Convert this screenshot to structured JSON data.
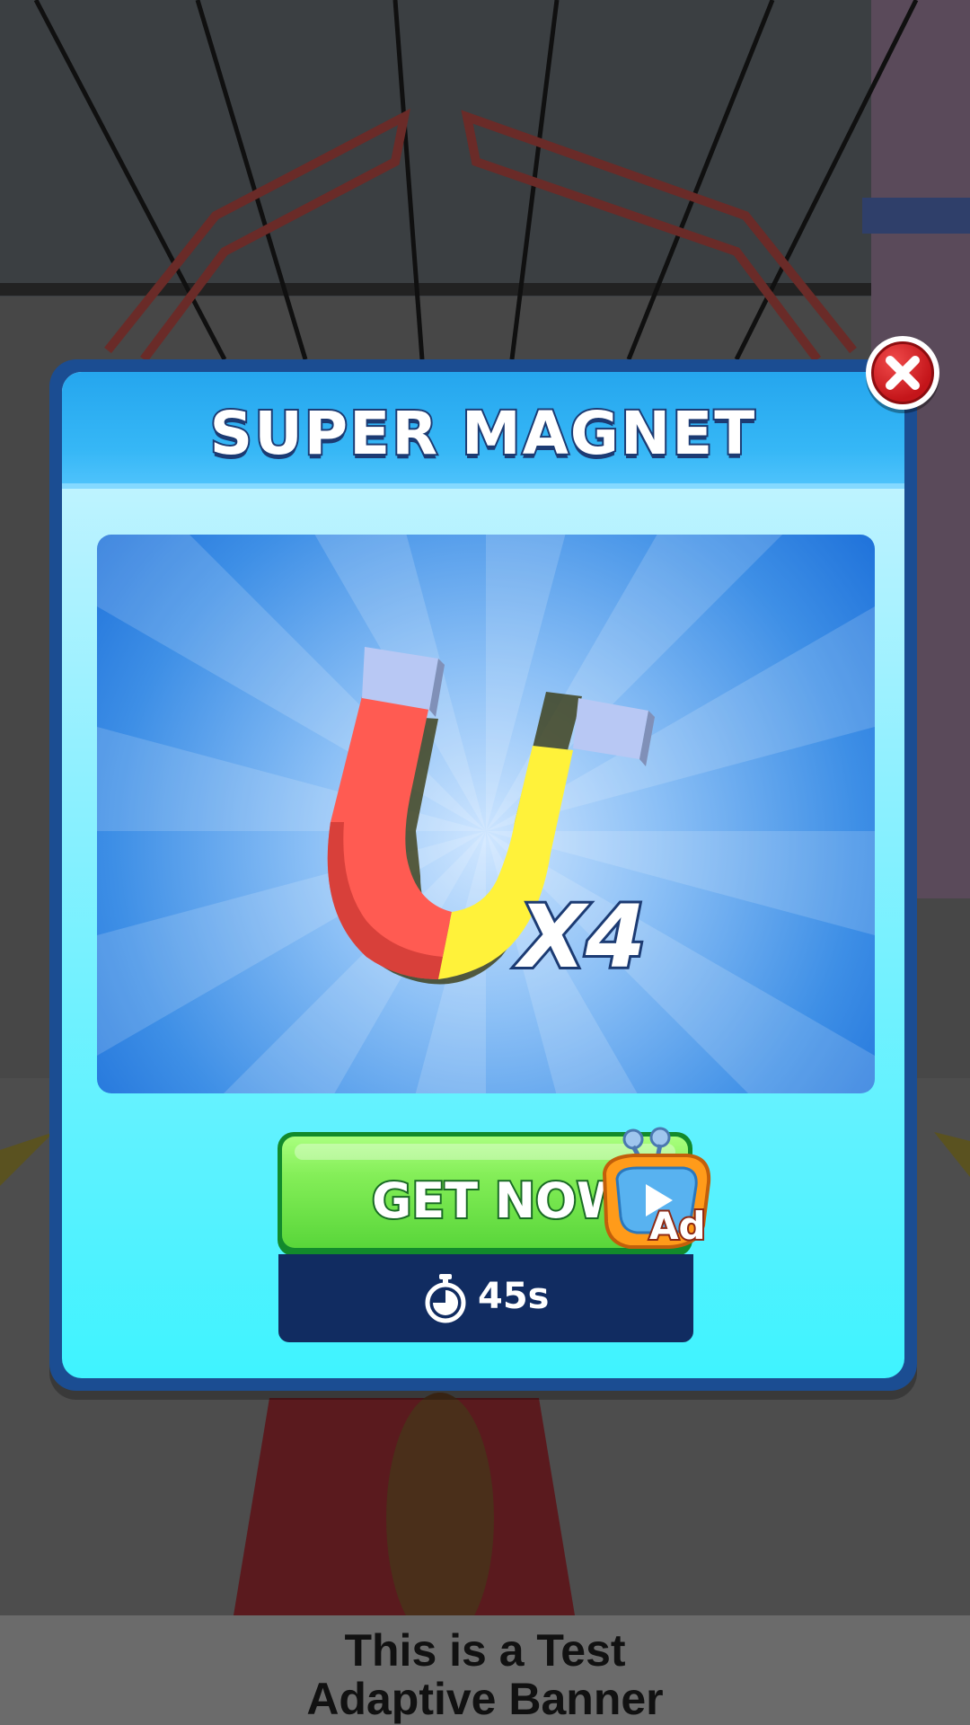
{
  "popup": {
    "title": "SUPER MAGNET",
    "multiplier": "X4",
    "get_now_label": "GET NOW",
    "ad_badge_label": "Ad",
    "timer_text": "45s"
  },
  "banner": {
    "line1": "This is a Test",
    "line2": "Adaptive Banner"
  },
  "icons": {
    "close": "close-icon",
    "magnet": "magnet-icon",
    "ad_tv": "tv-play-icon",
    "stopwatch": "stopwatch-icon"
  },
  "colors": {
    "popup_border": "#1b4d92",
    "header": "#36b7f6",
    "button_green": "#59d63a",
    "timer_bg": "#112c61",
    "close_red": "#c4151a"
  }
}
